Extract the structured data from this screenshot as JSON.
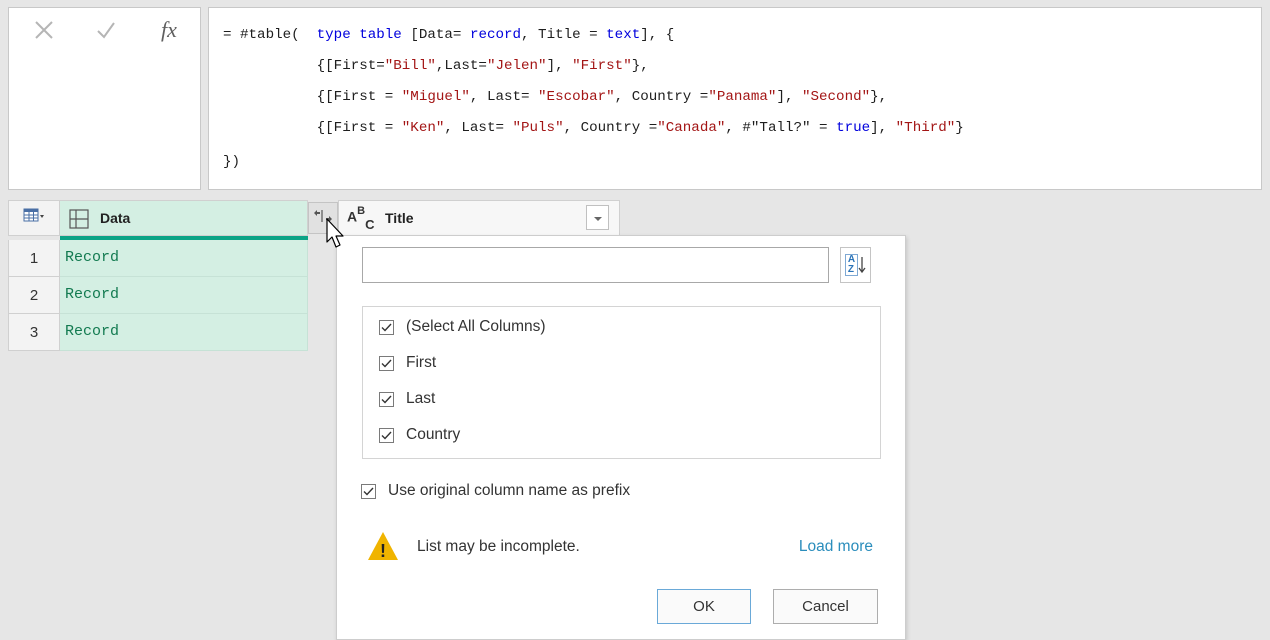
{
  "formula_bar": {
    "lines": [
      [
        {
          "t": "= #table(  ",
          "c": ""
        },
        {
          "t": "type",
          "c": "kw"
        },
        {
          "t": " ",
          "c": ""
        },
        {
          "t": "table",
          "c": "kw"
        },
        {
          "t": " [Data= ",
          "c": ""
        },
        {
          "t": "record",
          "c": "kw"
        },
        {
          "t": ", Title = ",
          "c": ""
        },
        {
          "t": "text",
          "c": "kw"
        },
        {
          "t": "], {",
          "c": ""
        }
      ],
      [
        {
          "t": "           {[First=",
          "c": ""
        },
        {
          "t": "\"Bill\"",
          "c": "str"
        },
        {
          "t": ",Last=",
          "c": ""
        },
        {
          "t": "\"Jelen\"",
          "c": "str"
        },
        {
          "t": "], ",
          "c": ""
        },
        {
          "t": "\"First\"",
          "c": "str"
        },
        {
          "t": "},",
          "c": ""
        }
      ],
      [
        {
          "t": "           {[First = ",
          "c": ""
        },
        {
          "t": "\"Miguel\"",
          "c": "str"
        },
        {
          "t": ", Last= ",
          "c": ""
        },
        {
          "t": "\"Escobar\"",
          "c": "str"
        },
        {
          "t": ", Country =",
          "c": ""
        },
        {
          "t": "\"Panama\"",
          "c": "str"
        },
        {
          "t": "], ",
          "c": ""
        },
        {
          "t": "\"Second\"",
          "c": "str"
        },
        {
          "t": "},",
          "c": ""
        }
      ],
      [
        {
          "t": "           {[First = ",
          "c": ""
        },
        {
          "t": "\"Ken\"",
          "c": "str"
        },
        {
          "t": ", Last= ",
          "c": ""
        },
        {
          "t": "\"Puls\"",
          "c": "str"
        },
        {
          "t": ", Country =",
          "c": ""
        },
        {
          "t": "\"Canada\"",
          "c": "str"
        },
        {
          "t": ", #\"Tall?\" = ",
          "c": ""
        },
        {
          "t": "true",
          "c": "kw"
        },
        {
          "t": "], ",
          "c": ""
        },
        {
          "t": "\"Third\"",
          "c": "str"
        },
        {
          "t": "}",
          "c": ""
        }
      ],
      [
        {
          "t": "})",
          "c": ""
        }
      ]
    ],
    "icons": [
      "cancel-icon",
      "check-icon",
      "fx-icon"
    ],
    "fx_label": "fx"
  },
  "grid": {
    "columns": [
      {
        "name": "Data",
        "type_icon": "record-type-icon",
        "header_color": "#d4efe3"
      },
      {
        "name": "Title",
        "type_icon": "text-type-icon",
        "type_label_a": "A",
        "type_label_b": "B",
        "type_label_c": "C"
      }
    ],
    "rows": [
      {
        "num": "1",
        "data": "Record"
      },
      {
        "num": "2",
        "data": "Record"
      },
      {
        "num": "3",
        "data": "Record"
      }
    ],
    "accent_color": "#0ba486",
    "record_text_color": "#127a50"
  },
  "expand_popup": {
    "search_value": "",
    "sort_icon": "sort-az-icon",
    "sort_label_a": "A",
    "sort_label_z": "Z",
    "columns": [
      {
        "label": "(Select All Columns)",
        "checked": true
      },
      {
        "label": "First",
        "checked": true
      },
      {
        "label": "Last",
        "checked": true
      },
      {
        "label": "Country",
        "checked": true
      }
    ],
    "prefix_label": "Use original column name as prefix",
    "prefix_checked": true,
    "warning_text": "List may be incomplete.",
    "warning_symbol": "!",
    "load_more": "Load more",
    "ok_label": "OK",
    "cancel_label": "Cancel",
    "warning_color": "#f0b400",
    "link_color": "#2a8dbc"
  }
}
